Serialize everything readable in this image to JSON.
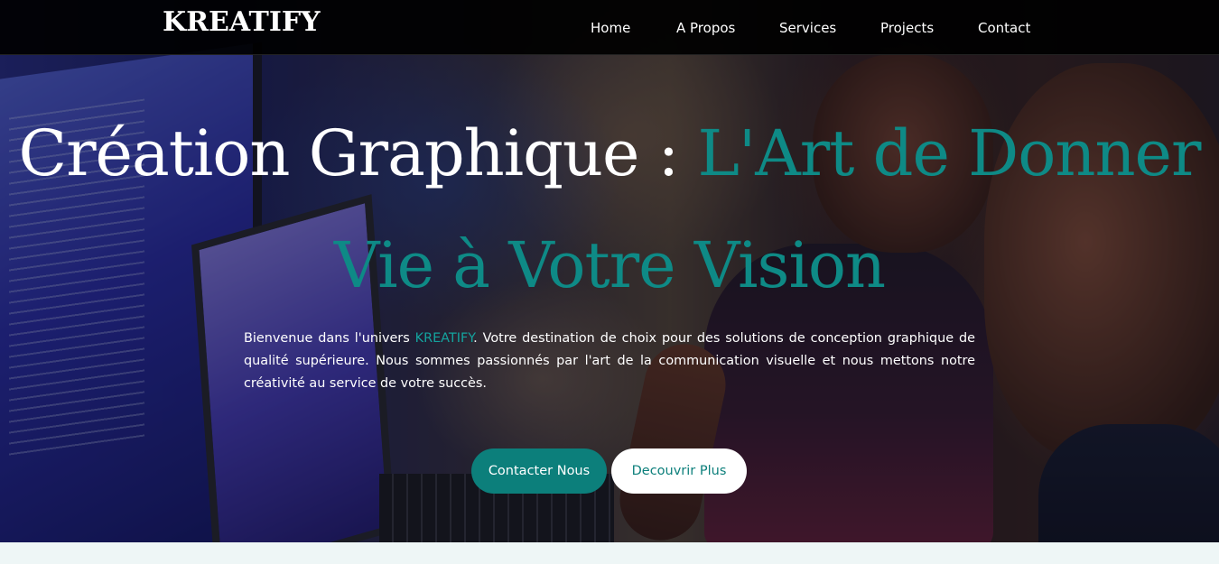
{
  "brand": {
    "logo": "KREATIFY"
  },
  "nav": {
    "home": "Home",
    "apropos": "A Propos",
    "services": "Services",
    "projects": "Projects",
    "contact": "Contact"
  },
  "hero": {
    "title_part1": "Création Graphique : ",
    "title_part2": "L'Art de Donner Vie à Votre Vision",
    "description_before": "Bienvenue dans l'univers ",
    "description_brand": "KREATIFY",
    "description_after": ". Votre destination de choix pour des solutions de conception graphique de qualité supérieure. Nous sommes passionnés par l'art de la communication visuelle et nous mettons notre créativité au service de votre succès.",
    "btn_primary": "Contacter Nous",
    "btn_secondary": "Decouvrir Plus",
    "background_image": "hero-photo-people-at-computers"
  },
  "colors": {
    "accent": "#0c7f7b",
    "navbar": "#000000",
    "text": "#ffffff"
  }
}
